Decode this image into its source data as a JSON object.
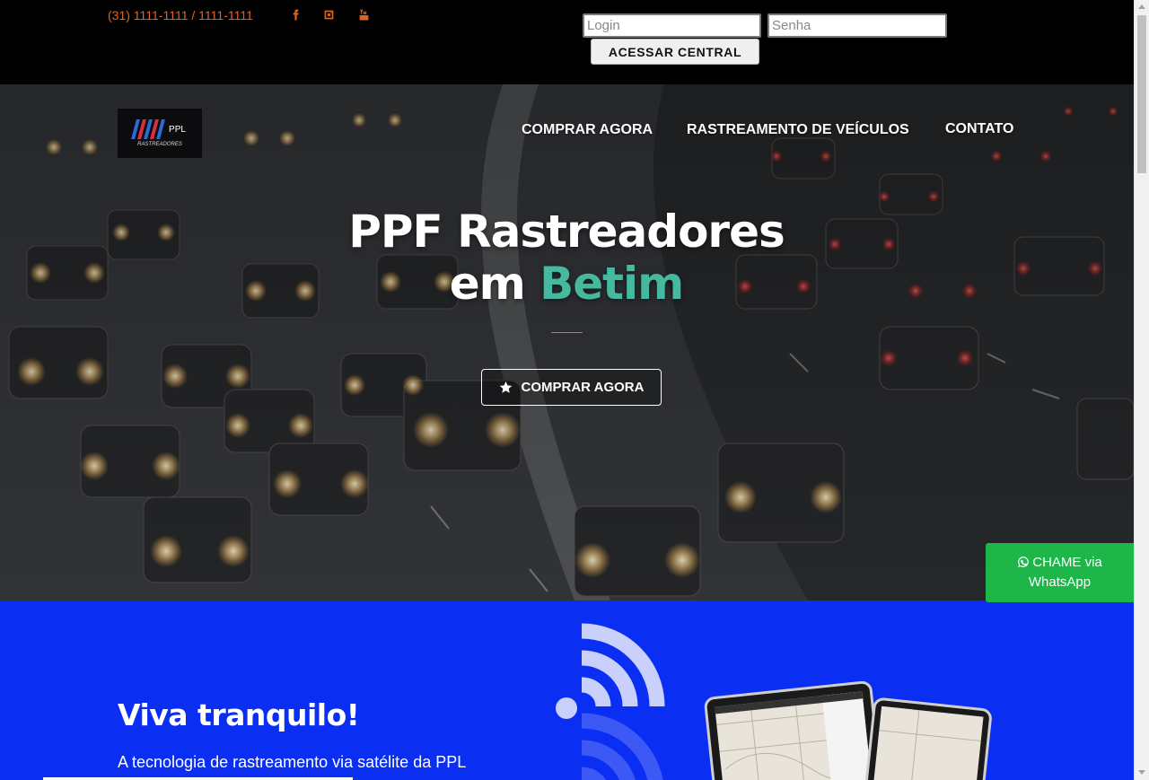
{
  "topbar": {
    "phone": "(31) 1111-1111 / 1111-1111",
    "social": [
      "facebook-icon",
      "instagram-icon",
      "youtube-icon"
    ],
    "login_placeholder": "Login",
    "password_placeholder": "Senha",
    "access_button": "ACESSAR CENTRAL",
    "accent_color": "#e0641f"
  },
  "header": {
    "logo_text": "PPL",
    "logo_subtext": "RASTREADORES",
    "nav": [
      "COMPRAR AGORA",
      "RASTREAMENTO DE VEÍCULOS",
      "CONTATO"
    ]
  },
  "hero": {
    "title_line1": "PPF Rastreadores",
    "title_line2_prefix": "em",
    "title_line2_accent": "Betim",
    "accent_color": "#47b8a0",
    "cta_label": "COMPRAR AGORA",
    "cta_icon": "star-icon"
  },
  "whatsapp": {
    "line1": "CHAME via",
    "line2": "WhatsApp",
    "icon": "whatsapp-icon",
    "color": "#1eb649"
  },
  "features": {
    "title": "Viva tranquilo!",
    "text": "A tecnologia de rastreamento via satélite da PPL",
    "background": "#0b2ff2"
  }
}
